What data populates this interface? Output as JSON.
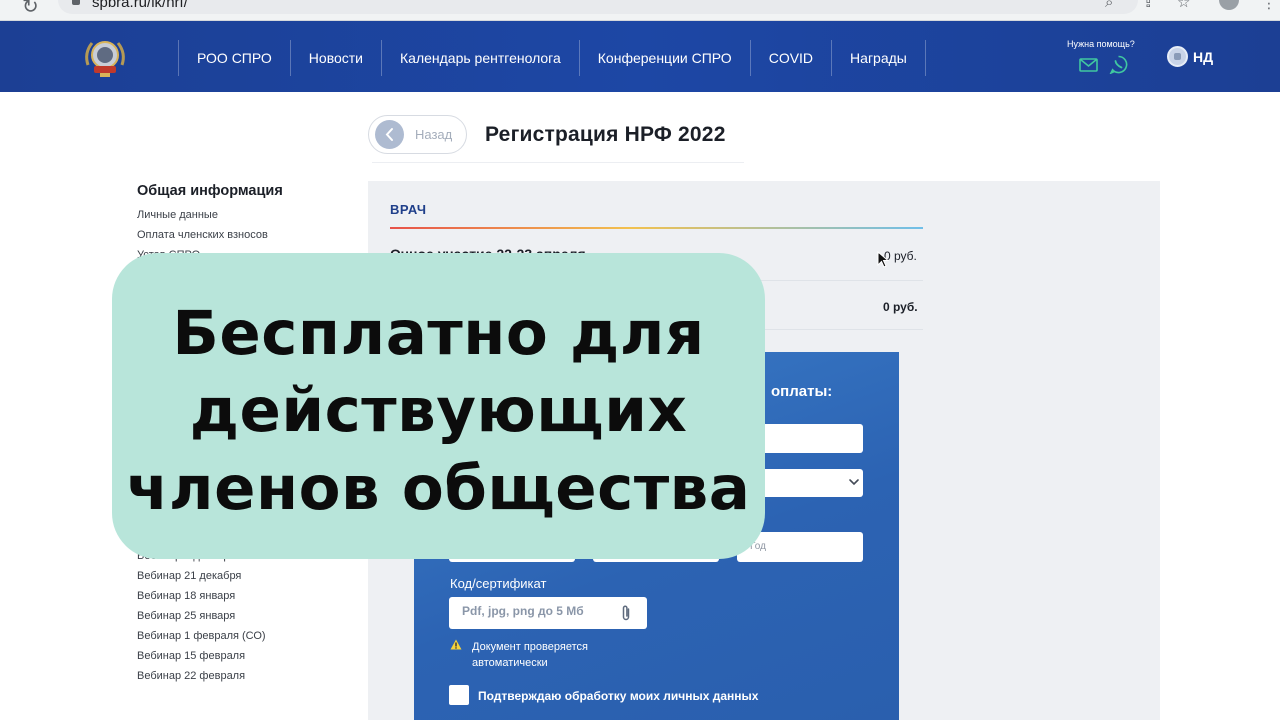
{
  "browser": {
    "url": "spbra.ru/lk/nrf/",
    "reload_icon": "reload-icon",
    "icons": [
      "search-icon",
      "share-icon",
      "star-icon",
      "globe-icon",
      "profile-icon",
      "menu-icon"
    ]
  },
  "header": {
    "logo_icon": "spro-logo",
    "nav": [
      "РОО СПРО",
      "Новости",
      "Календарь рентгенолога",
      "Конференции СПРО",
      "COVID",
      "Награды"
    ],
    "help_label": "Нужна помощь?",
    "user_initials": "НД",
    "colors": {
      "header_bg": "#1c3f94",
      "whatsapp": "#40c8a0"
    }
  },
  "page": {
    "back_label": "Назад",
    "title": "Регистрация НРФ 2022"
  },
  "sidebar": {
    "heading": "Общая информация",
    "links_top": [
      "Личные данные",
      "Оплата членских взносов",
      "Устав СПРО"
    ],
    "links_bottom": [
      "Вебинар 7 декабря",
      "Вебинар 21 декабря",
      "Вебинар 18 января",
      "Вебинар 25 января",
      "Вебинар 1 февраля (СО)",
      "Вебинар 15 февраля",
      "Вебинар 22 февраля"
    ]
  },
  "main": {
    "section_label": "ВРАЧ",
    "rows": [
      {
        "label": "Очное участие 22-23 апреля",
        "price": "0 руб."
      },
      {
        "label": "",
        "price": "0 руб."
      }
    ]
  },
  "form": {
    "title_fragment": "оплаты:",
    "year_placeholder": "Год",
    "cert_label": "Код/сертификат",
    "upload_placeholder": "Pdf, jpg, png до 5 Мб",
    "warning_text": "Документ проверяется автоматически",
    "consent_label": "Подтверждаю обработку моих личных данных",
    "consent_checked": false
  },
  "overlay": {
    "lines": [
      "Бесплатно для",
      "действующих",
      "членов общества"
    ],
    "color": "#b8e5da"
  }
}
